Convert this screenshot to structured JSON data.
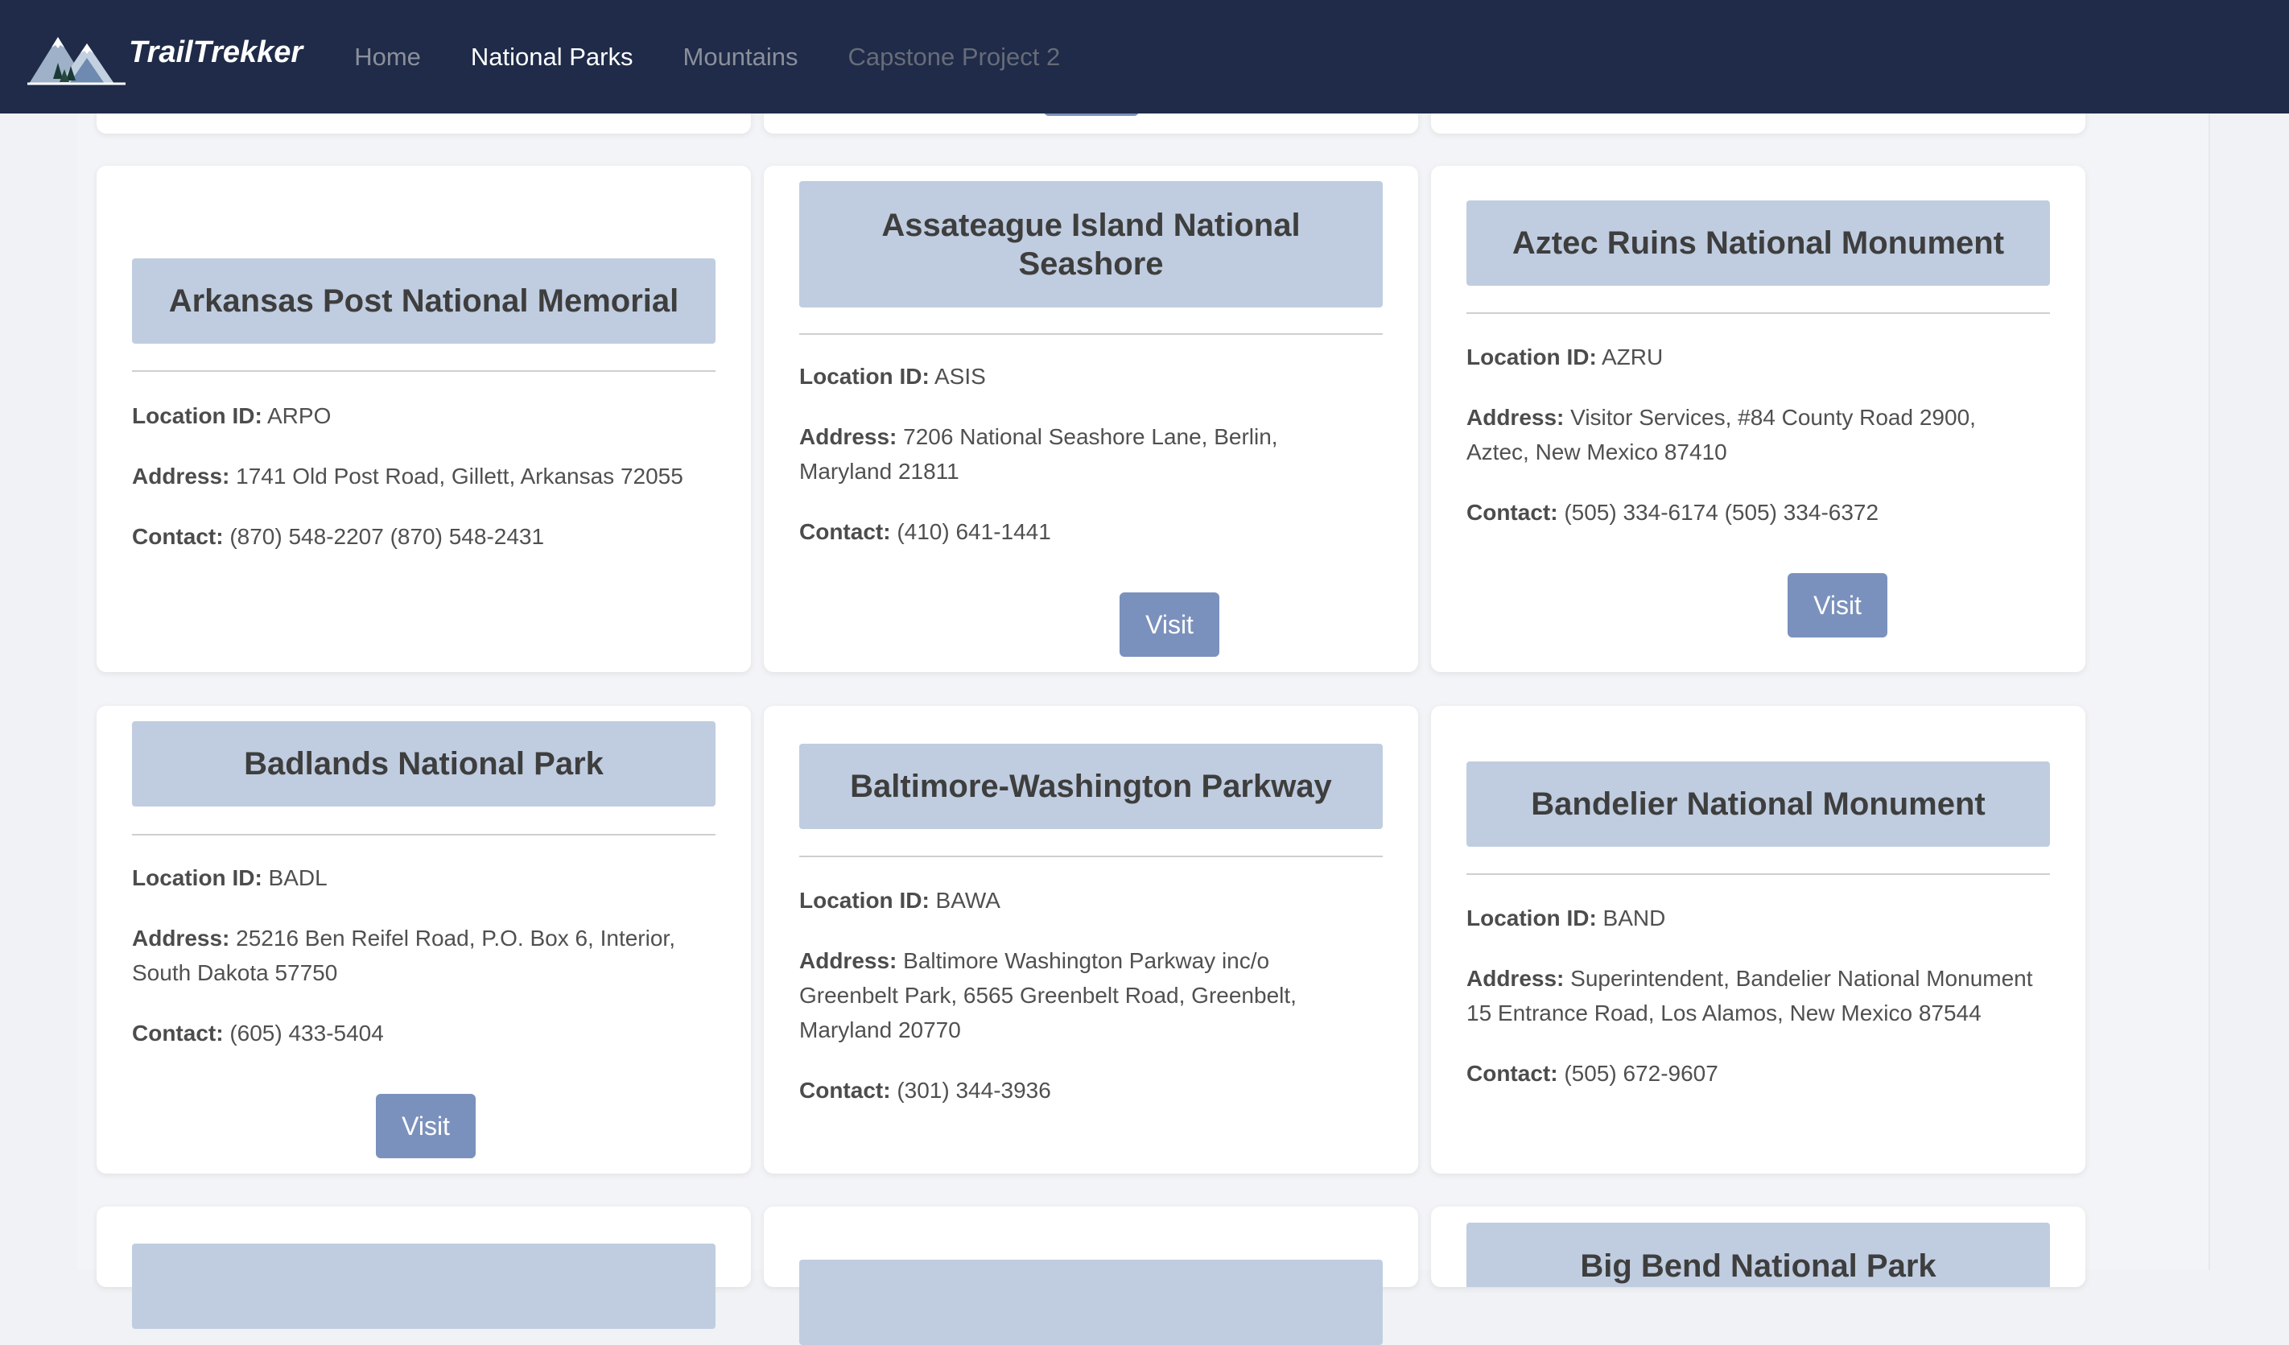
{
  "nav": {
    "brand": "TrailTrekker",
    "links": [
      "Home",
      "National Parks",
      "Mountains",
      "Capstone Project 2"
    ]
  },
  "labels": {
    "location": "Location ID:",
    "address": "Address:",
    "contact": "Contact:"
  },
  "parks": [
    {
      "name": "Arkansas Post National Memorial",
      "id": "ARPO",
      "address": "1741 Old Post Road, Gillett, Arkansas 72055",
      "contact": "(870) 548-2207 (870) 548-2431"
    },
    {
      "name": "Assateague Island National Seashore",
      "id": "ASIS",
      "address": "7206 National Seashore Lane, Berlin, Maryland 21811",
      "contact": "(410) 641-1441",
      "button": "Visit"
    },
    {
      "name": "Aztec Ruins National Monument",
      "id": "AZRU",
      "address": "Visitor Services, #84 County Road 2900, Aztec, New Mexico 87410",
      "contact": "(505) 334-6174 (505) 334-6372",
      "button": "Visit"
    },
    {
      "name": "Badlands National Park",
      "id": "BADL",
      "address": "25216 Ben Reifel Road, P.O. Box 6, Interior, South Dakota 57750",
      "contact": "(605) 433-5404",
      "button": "Visit"
    },
    {
      "name": "Baltimore-Washington Parkway",
      "id": "BAWA",
      "address": "Baltimore Washington Parkway inc/o Greenbelt Park, 6565 Greenbelt Road, Greenbelt, Maryland 20770",
      "contact": "(301) 344-3936"
    },
    {
      "name": "Bandelier National Monument",
      "id": "BAND",
      "address": "Superintendent, Bandelier National Monument 15 Entrance Road, Los Alamos, New Mexico 87544",
      "contact": "(505) 672-9607"
    }
  ],
  "next_row": {
    "right_title": "Big Bend National Park"
  },
  "colors": {
    "navbar": "#1f2b48",
    "card_header": "#c0cde0",
    "button": "#7b91bd",
    "page_bg": "#f0f2f5"
  }
}
